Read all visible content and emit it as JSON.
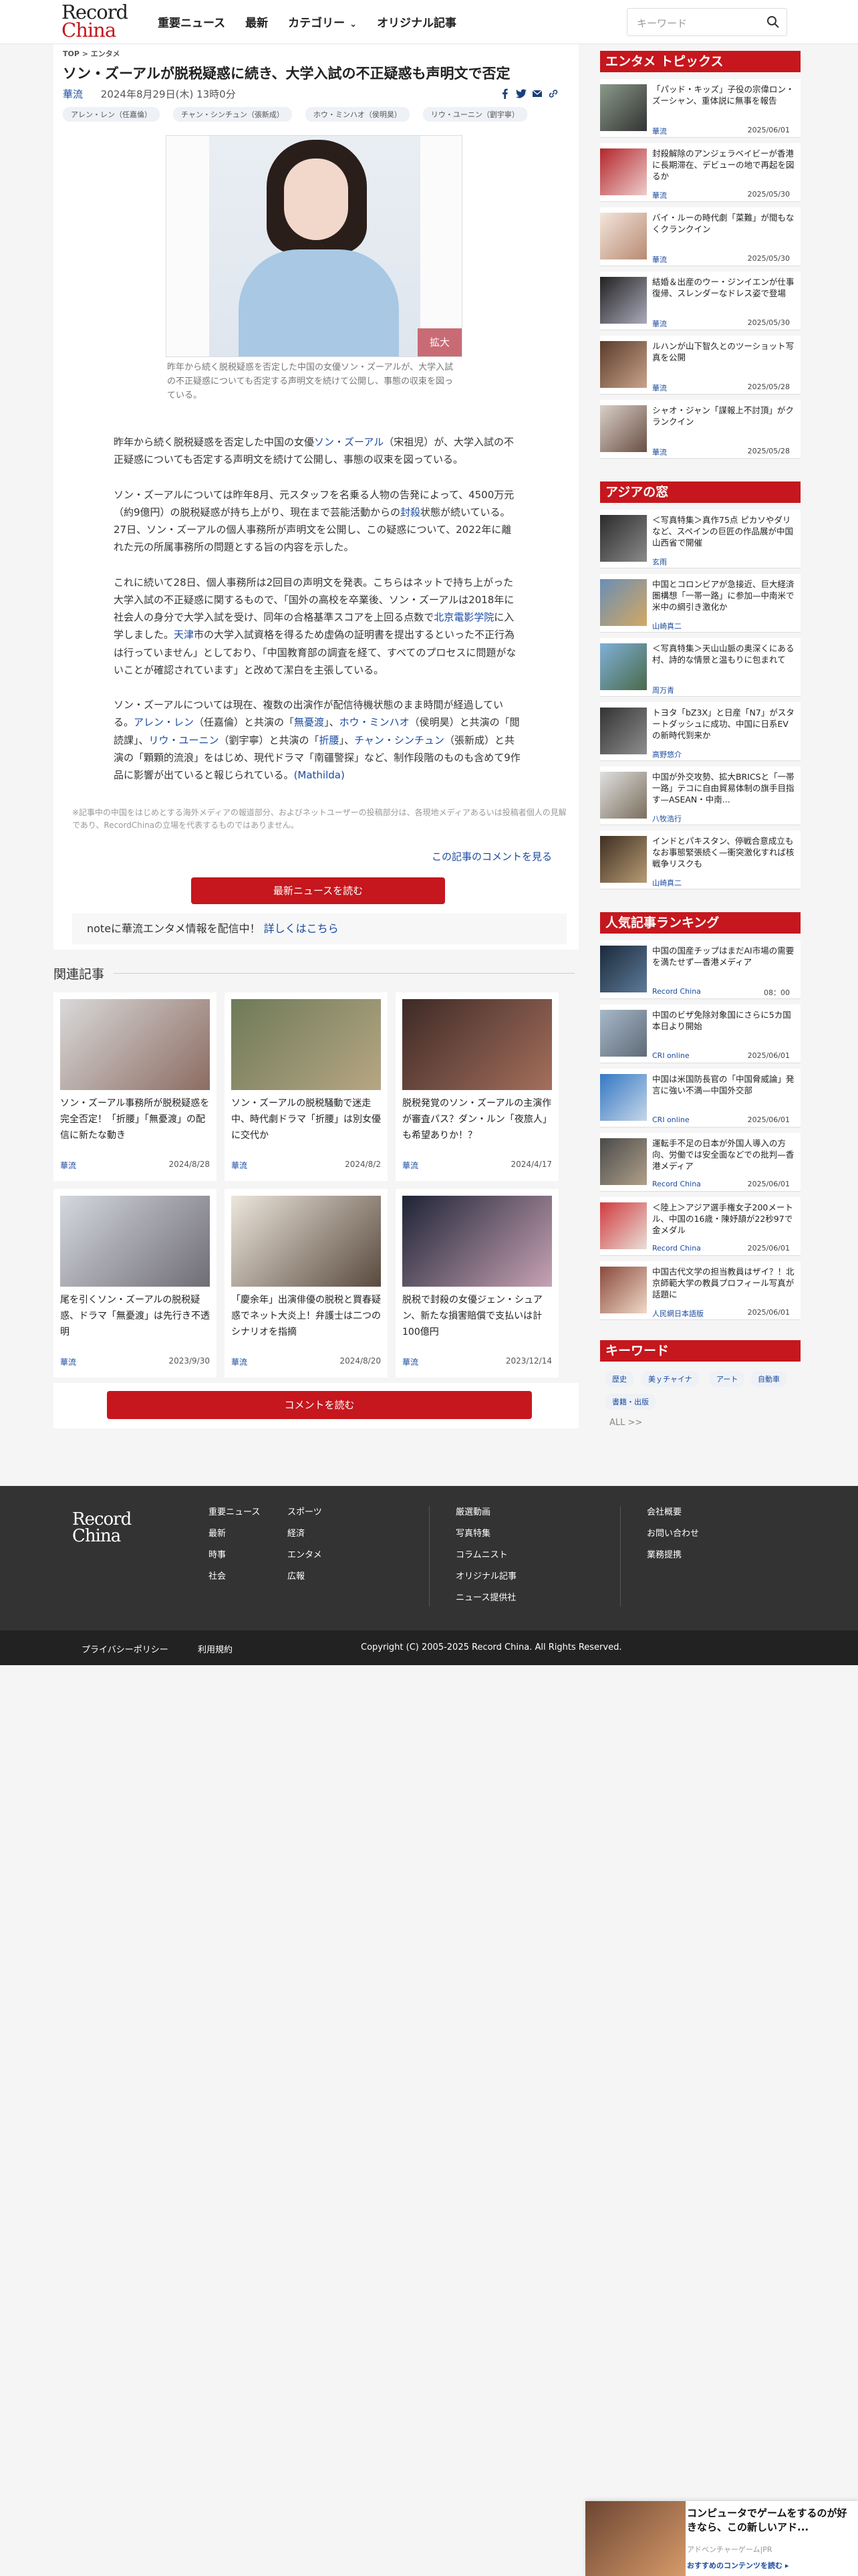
{
  "header": {
    "logo_line1": "Record",
    "logo_line2": "China",
    "nav": [
      "重要ニュース",
      "最新",
      "カテゴリー",
      "オリジナル記事"
    ],
    "search_placeholder": "キーワード"
  },
  "article": {
    "breadcrumb": "TOP > エンタメ",
    "title": "ソン・ズーアルが脱税疑惑に続き、大学入試の不正疑惑も声明文で否定",
    "category": "華流",
    "date": "2024年8月29日(木) 13時0分",
    "tags": [
      "アレン・レン（任嘉倫）",
      "チャン・シンチュン（張新成）",
      "ホウ・ミンハオ（侯明昊）",
      "リウ・ユーニン（劉宇寧）"
    ],
    "zoom_label": "拡大",
    "caption": "昨年から続く脱税疑惑を否定した中国の女優ソン・ズーアルが、大学入試の不正疑惑についても否定する声明文を続けて公開し、事態の収束を図っている。",
    "paragraphs": [
      [
        "昨年から続く脱税疑惑を否定した中国の女優",
        "ソン・ズーアル",
        "（宋祖児）が、大学入試の不正疑惑についても否定する声明文を続けて公開し、事態の収束を図っている。"
      ],
      [
        "ソン・ズーアルについては昨年8月、元スタッフを名乗る人物の告発によって、4500万元（約9億円）の脱税疑惑が持ち上がり、現在まで芸能活動からの",
        "封殺",
        "状態が続いている。27日、ソン・ズーアルの個人事務所が声明文を公開し、この疑惑について、2022年に離れた元の所属事務所の問題とする旨の内容を示した。"
      ],
      [
        "これに続いて28日、個人事務所は2回目の声明文を発表。こちらはネットで持ち上がった大学入試の不正疑惑に関するもので、「国外の高校を卒業後、ソン・ズーアルは2018年に社会人の身分で大学入試を受け、同年の合格基準スコアを上回る点数で",
        "北京電影学院",
        "に入学しました。",
        "天津",
        "市の大学入試資格を得るため虚偽の証明書を提出するといった不正行為は行っていません」としており、「中国教育部の調査を経て、すべてのプロセスに問題がないことが確認されています」と改めて潔白を主張している。"
      ],
      [
        "ソン・ズーアルについては現在、複数の出演作が配信待機状態のまま時間が経過している。",
        "アレン・レン",
        "（任嘉倫）と共演の「",
        "無憂渡",
        "」、",
        "ホウ・ミンハオ",
        "（侯明昊）と共演の「閲読課」、",
        "リウ・ユーニン",
        "（劉宇寧）と共演の「",
        "折腰",
        "」、",
        "チャン・シンチュン",
        "（張新成）と共演の「顆顆的流浪」をはじめ、現代ドラマ「南疆警探」など、制作段階のものも含めて9作品に影響が出ていると報じられている。",
        "(Mathilda)"
      ]
    ],
    "note": "※記事中の中国をはじめとする海外メディアの報道部分、およびネットユーザーの投稿部分は、各現地メディアあるいは投稿者個人の見解であり、RecordChinaの立場を代表するものではありません。",
    "comments_link": "この記事のコメントを見る",
    "latest_button": "最新ニュースを読む",
    "notebox_text": "noteに華流エンタメ情報を配信中！",
    "notebox_link": "詳しくはこちら",
    "comment_button": "コメントを読む"
  },
  "related": {
    "heading": "関連記事",
    "items": [
      {
        "title": "ソン・ズーアル事務所が脱税疑惑を完全否定！「折腰」「無憂渡」の配信に新たな動き",
        "cat": "華流",
        "date": "2024/8/28"
      },
      {
        "title": "ソン・ズーアルの脱税騒動で迷走中、時代劇ドラマ「折腰」は別女優に交代か",
        "cat": "華流",
        "date": "2024/8/2"
      },
      {
        "title": "脱税発覚のソン・ズーアルの主演作が審査パス？ダン・ルン「夜旅人」も希望ありか！？",
        "cat": "華流",
        "date": "2024/4/17"
      },
      {
        "title": "尾を引くソン・ズーアルの脱税疑惑、ドラマ「無憂渡」は先行き不透明",
        "cat": "華流",
        "date": "2023/9/30"
      },
      {
        "title": "「慶余年」出演俳優の脱税と買春疑惑でネット大炎上！弁護士は二つのシナリオを指摘",
        "cat": "華流",
        "date": "2024/8/20"
      },
      {
        "title": "脱税で封殺の女優ジェン・シュアン、新たな損害賠償で支払いは計100億円",
        "cat": "華流",
        "date": "2023/12/14"
      }
    ]
  },
  "sidebar": {
    "topics_heading": "エンタメ トピックス",
    "topics": [
      {
        "title": "「パッド・キッズ」子役の宗偉ロン・ズーシャン、重体説に無事を報告",
        "cat": "華流",
        "date": "2025/06/01"
      },
      {
        "title": "封殺解除のアンジェラベイビーが香港に長期滞在、デビューの地で再起を図るか",
        "cat": "華流",
        "date": "2025/05/30"
      },
      {
        "title": "バイ・ルーの時代劇「菜難」が間もなくクランクイン",
        "cat": "華流",
        "date": "2025/05/30"
      },
      {
        "title": "結婚＆出産のウー・ジンイエンが仕事復帰、スレンダーなドレス姿で登場",
        "cat": "華流",
        "date": "2025/05/30"
      },
      {
        "title": "ルハンが山下智久とのツーショット写真を公開",
        "cat": "華流",
        "date": "2025/05/28"
      },
      {
        "title": "シャオ・ジャン「謀報上不討頂」がクランクイン",
        "cat": "華流",
        "date": "2025/05/28"
      }
    ],
    "asia_heading": "アジアの窓",
    "asia": [
      {
        "title": "＜写真特集＞真作75点 ピカソやダリなど、スペインの巨匠の作品展が中国山西省で開催",
        "cat": "玄雨"
      },
      {
        "title": "中国とコロンビアが急接近、巨大経済圏構想「一帯一路」に参加—中南米で米中の綱引き激化か",
        "cat": "山崎真二"
      },
      {
        "title": "＜写真特集＞天山山脈の奥深くにある村、詩的な情景と温もりに包まれて",
        "cat": "周万青"
      },
      {
        "title": "トヨタ「bZ3X」と日産「N7」がスタートダッシュに成功、中国に日系EVの新時代到来か",
        "cat": "高野悠介"
      },
      {
        "title": "中国が外交攻勢、拡大BRICSと「一帯一路」テコに自由貿易体制の旗手目指す—ASEAN・中南...",
        "cat": "八牧浩行"
      },
      {
        "title": "インドとパキスタン、停戦合意成立もなお事態緊張続く—衝突激化すれば核戦争リスクも",
        "cat": "山崎真二"
      }
    ],
    "ranking_heading": "人気記事ランキング",
    "ranking": [
      {
        "title": "中国の国産チップはまだAI市場の需要を満たせず—香港メディア",
        "cat": "Record China",
        "date": "08：00"
      },
      {
        "title": "中国のビザ免除対象国にさらに5カ国 本日より開始",
        "cat": "CRI online",
        "date": "2025/06/01"
      },
      {
        "title": "中国は米国防長官の「中国脅威論」発言に強い不満—中国外交部",
        "cat": "CRI online",
        "date": "2025/06/01"
      },
      {
        "title": "運転手不足の日本が外国人導入の方向、労働では安全面などでの批判—香港メディア",
        "cat": "Record China",
        "date": "2025/06/01"
      },
      {
        "title": "＜陸上＞アジア選手権女子200メートル、中国の16歳・陳妤頡が22秒97で金メダル",
        "cat": "Record China",
        "date": "2025/06/01"
      },
      {
        "title": "中国古代文学の担当教員はザイ？！北京師範大学の教員プロフィール写真が話題に",
        "cat": "人民網日本語版",
        "date": "2025/06/01"
      }
    ],
    "keyword_heading": "キーワード",
    "keywords": [
      "歴史",
      "美ｙチャイナ",
      "アート",
      "自動車",
      "書籍・出版"
    ],
    "all_label": "ALL >>"
  },
  "footer": {
    "col1": [
      "重要ニュース",
      "最新",
      "時事",
      "社会"
    ],
    "col2": [
      "スポーツ",
      "経済",
      "エンタメ",
      "広報"
    ],
    "col3": [
      "厳選動画",
      "写真特集",
      "コラムニスト",
      "オリジナル記事",
      "ニュース提供社"
    ],
    "col4": [
      "会社概要",
      "お問い合わせ",
      "業務提携"
    ],
    "privacy": "プライバシーポリシー",
    "terms": "利用規約",
    "copyright": "Copyright (C) 2005-2025 Record China. All Rights Reserved."
  },
  "ad": {
    "title": "コンピュータでゲームをするのが好きなら、この新しいアド...",
    "sponsor": "アドベンチャーゲーム|PR",
    "link": "おすすめのコンテンツを読む ▸"
  },
  "colors": {
    "brand_red": "#c5171d",
    "link_blue": "#1a4ba0",
    "footer_bg": "#333333"
  }
}
